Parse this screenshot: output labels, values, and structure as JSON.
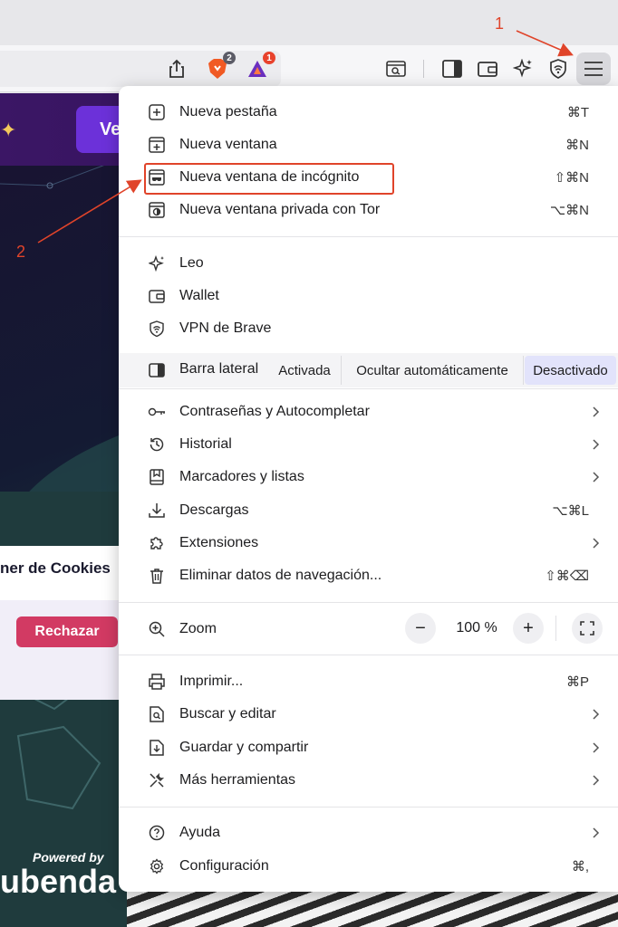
{
  "toolbar": {
    "brave_shields_badge": "2",
    "rewards_badge": "1",
    "icons": [
      "share-icon",
      "brave-shields-icon",
      "brave-rewards-icon",
      "reader-mode-icon",
      "sidebar-toggle-icon",
      "wallet-icon",
      "leo-icon",
      "vpn-icon",
      "hamburger-menu-icon"
    ]
  },
  "page": {
    "button_partial": "Ve",
    "cookie_title_partial": "ner de Cookies",
    "reject_button": "Rechazar",
    "powered_by": "Powered by",
    "brand_partial": "ubenda"
  },
  "menu": {
    "group1": [
      {
        "label": "Nueva pestaña",
        "shortcut": "⌘T",
        "icon": "new-tab-icon"
      },
      {
        "label": "Nueva ventana",
        "shortcut": "⌘N",
        "icon": "new-window-icon"
      },
      {
        "label": "Nueva ventana de incógnito",
        "shortcut": "⇧⌘N",
        "icon": "incognito-window-icon"
      },
      {
        "label": "Nueva ventana privada con Tor",
        "shortcut": "⌥⌘N",
        "icon": "tor-window-icon"
      }
    ],
    "group2": [
      {
        "label": "Leo",
        "icon": "leo-icon"
      },
      {
        "label": "Wallet",
        "icon": "wallet-icon"
      },
      {
        "label": "VPN de Brave",
        "icon": "vpn-icon"
      }
    ],
    "sidebar": {
      "label": "Barra lateral",
      "options": [
        "Activada",
        "Ocultar automáticamente",
        "Desactivado"
      ],
      "selected": "Desactivado"
    },
    "group3": [
      {
        "label": "Contraseñas y Autocompletar",
        "shortcut": "",
        "submenu": true,
        "icon": "key-icon"
      },
      {
        "label": "Historial",
        "shortcut": "",
        "submenu": true,
        "icon": "history-icon"
      },
      {
        "label": "Marcadores y listas",
        "shortcut": "",
        "submenu": true,
        "icon": "bookmarks-icon"
      },
      {
        "label": "Descargas",
        "shortcut": "⌥⌘L",
        "submenu": false,
        "icon": "download-icon"
      },
      {
        "label": "Extensiones",
        "shortcut": "",
        "submenu": true,
        "icon": "puzzle-icon"
      },
      {
        "label": "Eliminar datos de navegación...",
        "shortcut": "⇧⌘⌫",
        "submenu": false,
        "icon": "trash-icon"
      }
    ],
    "zoom": {
      "label": "Zoom",
      "value": "100 %",
      "minus": "−",
      "plus": "+"
    },
    "group4": [
      {
        "label": "Imprimir...",
        "shortcut": "⌘P",
        "submenu": false,
        "icon": "print-icon"
      },
      {
        "label": "Buscar y editar",
        "shortcut": "",
        "submenu": true,
        "icon": "find-icon"
      },
      {
        "label": "Guardar y compartir",
        "shortcut": "",
        "submenu": true,
        "icon": "save-icon"
      },
      {
        "label": "Más herramientas",
        "shortcut": "",
        "submenu": true,
        "icon": "tools-icon"
      }
    ],
    "group5": [
      {
        "label": "Ayuda",
        "shortcut": "",
        "submenu": true,
        "icon": "help-icon"
      },
      {
        "label": "Configuración",
        "shortcut": "⌘,",
        "submenu": false,
        "icon": "settings-icon"
      }
    ]
  },
  "annotations": {
    "step1": "1",
    "step2": "2",
    "color": "#e0442a"
  }
}
